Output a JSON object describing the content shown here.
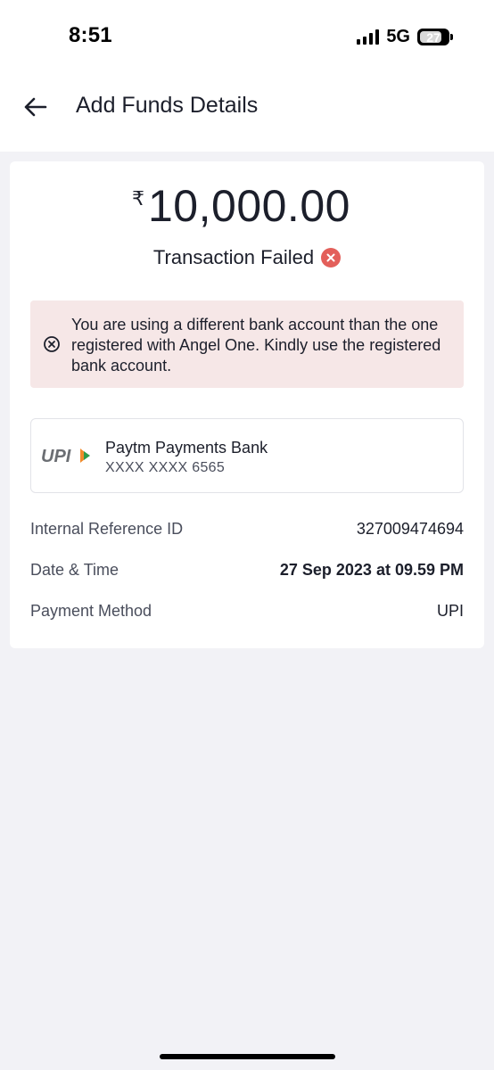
{
  "status_bar": {
    "time": "8:51",
    "network": "5G",
    "battery": "27"
  },
  "header": {
    "title": "Add Funds Details"
  },
  "transaction": {
    "currency_symbol": "₹",
    "amount": "10,000.00",
    "status": "Transaction Failed",
    "status_color": "#e35f5a"
  },
  "alert": {
    "message": "You are using a different bank account than the one registered with Angel One. Kindly use the registered bank account.",
    "background": "#f6e7e7"
  },
  "bank": {
    "logo_text": "UPI",
    "name": "Paytm Payments Bank",
    "account": "XXXX XXXX 6565"
  },
  "details": [
    {
      "label": "Internal Reference ID",
      "value": "327009474694"
    },
    {
      "label": "Date & Time",
      "value": "27 Sep 2023 at 09.59 PM"
    },
    {
      "label": "Payment Method",
      "value": "UPI"
    }
  ],
  "icons": {
    "back": "arrow-left-icon",
    "fail": "close-circle-icon",
    "alert": "close-circle-outline-icon",
    "signal": "cellular-signal-icon",
    "battery": "battery-icon"
  }
}
